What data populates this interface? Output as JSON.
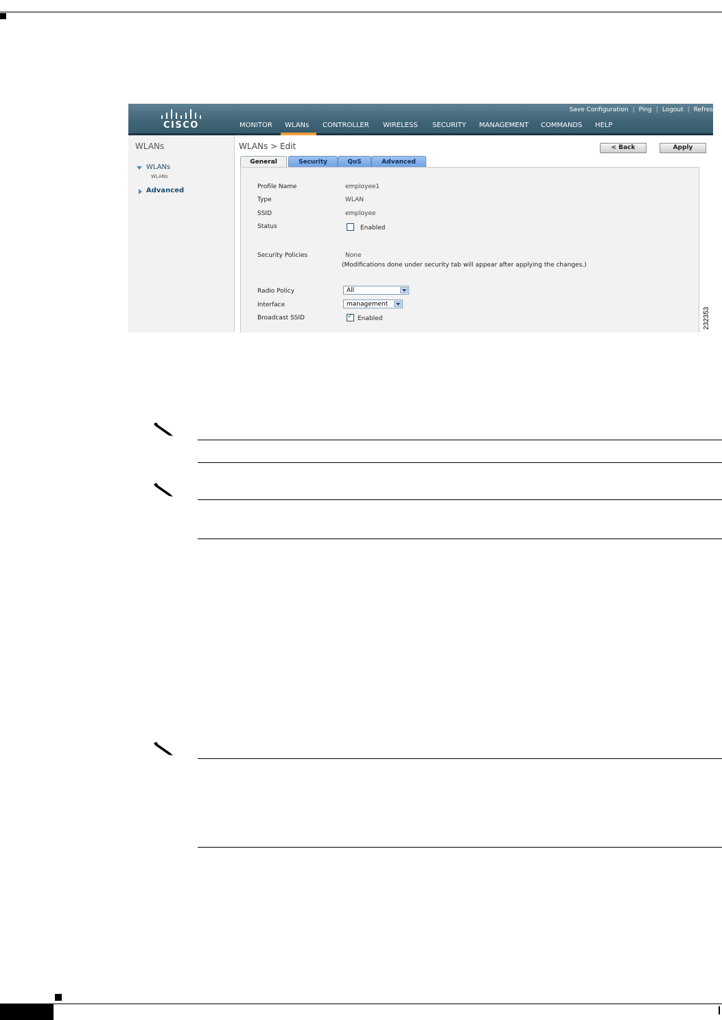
{
  "header": {
    "logo_text": "CISCO",
    "top_links": [
      "Save Configuration",
      "Ping",
      "Logout",
      "Refres"
    ],
    "nav": [
      "MONITOR",
      "WLANs",
      "CONTROLLER",
      "WIRELESS",
      "SECURITY",
      "MANAGEMENT",
      "COMMANDS",
      "HELP"
    ],
    "active_nav": "WLANs",
    "accent_color": "#f2a03d"
  },
  "sidebar": {
    "title": "WLANs",
    "items": [
      {
        "label": "WLANs",
        "sub": "WLANs",
        "expanded": true
      },
      {
        "label": "Advanced",
        "expanded": false
      }
    ]
  },
  "main": {
    "page_title": "WLANs > Edit",
    "back_label": "< Back",
    "apply_label": "Apply",
    "tabs": [
      "General",
      "Security",
      "QoS",
      "Advanced"
    ],
    "active_tab": "General",
    "fields": {
      "profile_name_label": "Profile Name",
      "profile_name": "employee1",
      "type_label": "Type",
      "type": "WLAN",
      "ssid_label": "SSID",
      "ssid": "employee",
      "status_label": "Status",
      "status_enabled_label": "Enabled",
      "status_checked": false,
      "security_policies_label": "Security Policies",
      "security_policies": "None",
      "security_note": "(Modifications done under security tab will appear after applying the changes.)",
      "radio_policy_label": "Radio Policy",
      "radio_policy": "All",
      "interface_label": "Interface",
      "interface": "management",
      "broadcast_ssid_label": "Broadcast SSID",
      "broadcast_enabled_label": "Enabled",
      "broadcast_checked": true
    }
  },
  "figure_number": "232353"
}
